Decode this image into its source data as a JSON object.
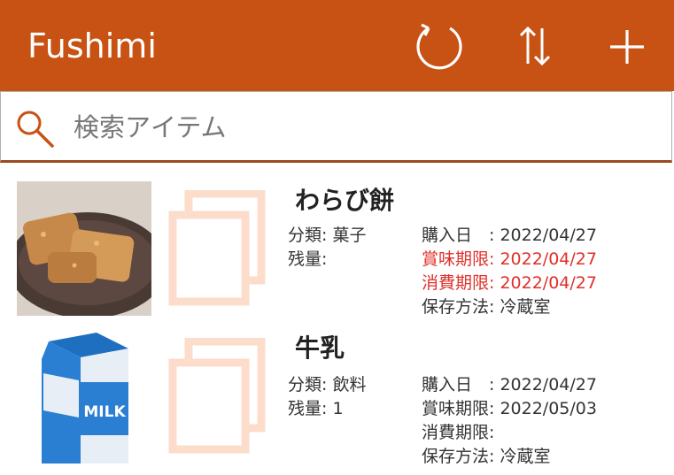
{
  "app": {
    "title": "Fushimi"
  },
  "header": {
    "refresh_icon": "refresh-icon",
    "sort_icon": "sort-icon",
    "add_icon": "plus-icon"
  },
  "search": {
    "placeholder": "検索アイテム",
    "value": ""
  },
  "colors": {
    "accent": "#c75213",
    "expired": "#e0302a",
    "copy_icon": "#fcdccb"
  },
  "items": [
    {
      "name": "わらび餅",
      "category": "分類: 菓子",
      "quantity": "残量:",
      "purchase": "購入日　: 2022/04/27",
      "best_before": "賞味期限: 2022/04/27",
      "use_by": "消費期限: 2022/04/27",
      "storage": "保存方法: 冷蔵室",
      "best_before_expired": true,
      "use_by_expired": true
    },
    {
      "name": "牛乳",
      "category": "分類: 飲料",
      "quantity": "残量: 1",
      "purchase": "購入日　: 2022/04/27",
      "best_before": "賞味期限: 2022/05/03",
      "use_by": "消費期限:",
      "storage": "保存方法: 冷蔵室",
      "best_before_expired": false,
      "use_by_expired": false,
      "image_label": "MILK"
    }
  ]
}
